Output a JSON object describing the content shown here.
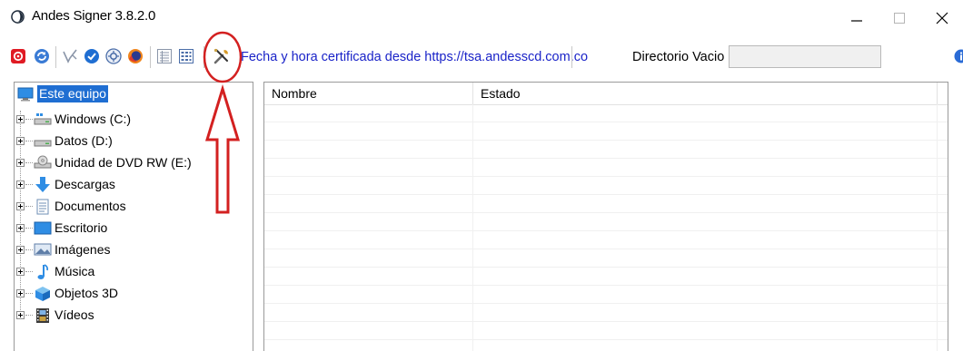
{
  "window": {
    "title": "Andes Signer 3.8.2.0",
    "minimize_icon": "minimize-icon",
    "maximize_icon": "maximize-icon",
    "close_icon": "close-icon"
  },
  "toolbar": {
    "icons": [
      "pdf-icon",
      "refresh-icon",
      "sign-pen-icon",
      "verify-check-icon",
      "settings-gear-icon",
      "firefox-icon",
      "details-view-icon",
      "list-view-icon",
      "tools-icon"
    ],
    "tsa_text": "Fecha y hora certificada desde https://tsa.andesscd.com.co",
    "directory_label": "Directorio Vacio",
    "directory_value": "",
    "help_icon": "help-icon"
  },
  "tree": {
    "root": "Este equipo",
    "items": [
      {
        "label": "Windows (C:)",
        "icon": "drive-icon"
      },
      {
        "label": "Datos (D:)",
        "icon": "drive-icon"
      },
      {
        "label": "Unidad de DVD RW (E:)",
        "icon": "dvd-drive-icon"
      },
      {
        "label": "Descargas",
        "icon": "download-arrow-icon"
      },
      {
        "label": "Documentos",
        "icon": "document-icon"
      },
      {
        "label": "Escritorio",
        "icon": "desktop-icon"
      },
      {
        "label": "Imágenes",
        "icon": "pictures-icon"
      },
      {
        "label": "Música",
        "icon": "music-note-icon"
      },
      {
        "label": "Objetos 3D",
        "icon": "cube-3d-icon"
      },
      {
        "label": "Vídeos",
        "icon": "film-icon"
      }
    ]
  },
  "file_list": {
    "columns": [
      "Nombre",
      "Estado"
    ],
    "rows": []
  },
  "colors": {
    "link_text": "#1a23c8",
    "selection": "#1f6ed2",
    "annotation": "#d32020"
  }
}
